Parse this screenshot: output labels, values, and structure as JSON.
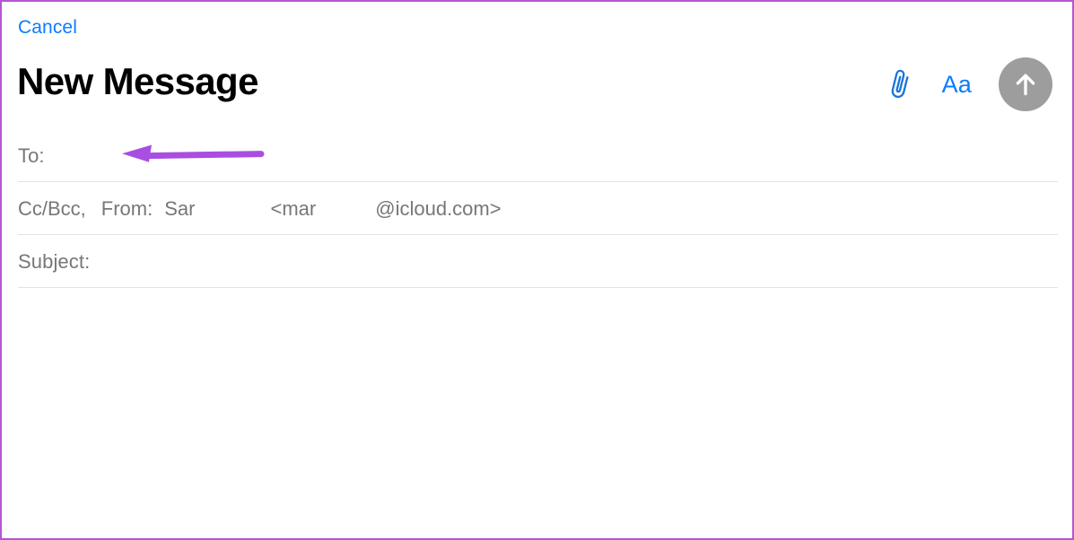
{
  "window": {
    "annotation_border_color": "#b357d4"
  },
  "header": {
    "cancel_label": "Cancel",
    "title": "New Message",
    "attach_icon": "paperclip-icon",
    "format_label": "Aa",
    "send_icon": "arrow-up-icon",
    "accent_color": "#0a7cff",
    "send_button_color": "#9d9d9d"
  },
  "fields": {
    "to": {
      "label": "To:",
      "value": ""
    },
    "ccbcc": {
      "label": "Cc/Bcc,",
      "from_label": "From:",
      "from_name": "Sar",
      "email_open": "<mar",
      "email_domain": "@icloud.com>"
    },
    "subject": {
      "label": "Subject:",
      "value": ""
    }
  },
  "body": {
    "value": "",
    "placeholder": ""
  },
  "annotation": {
    "arrow_color": "#a94ee0",
    "arrow_direction": "left",
    "points_at": "to-field-input"
  }
}
